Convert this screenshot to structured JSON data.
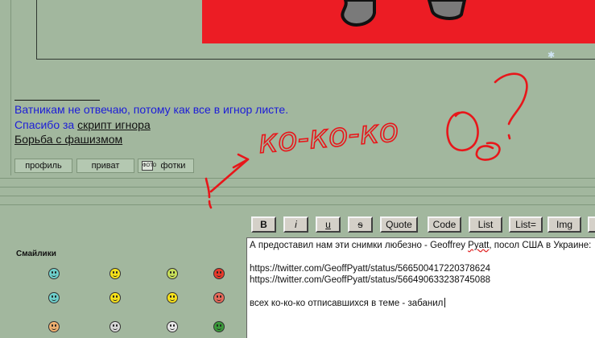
{
  "signature": {
    "line1": "Ватникам не отвечаю, потому как все в игнор листе.",
    "line2_prefix": "Спасибо за ",
    "line2_link": "скрипт игнора",
    "line3_link": "Борьба с фашизмом"
  },
  "post_buttons": {
    "profile": "профиль",
    "private": "приват",
    "photos": "фотки",
    "photos_icon_text": "ФОТО"
  },
  "scribble_text": "ко-ко-ко",
  "toolbar": {
    "bold": "B",
    "italic": "i",
    "underline": "u",
    "strike": "s",
    "quote": "Quote",
    "code": "Code",
    "list": "List",
    "list_eq": "List=",
    "img": "Img"
  },
  "smileys": {
    "title": "Смайлики",
    "items": [
      {
        "icon": "grin-smiley-icon",
        "color": "#6ed0cc"
      },
      {
        "icon": "smile-smiley-icon",
        "color": "#f7e21a"
      },
      {
        "icon": "smile-green-smiley-icon",
        "color": "#c8e05a"
      },
      {
        "icon": "angry-smiley-icon",
        "color": "#e83a2a"
      },
      {
        "icon": "cool-smiley-icon",
        "color": "#6ed0cc"
      },
      {
        "icon": "wink-smiley-icon",
        "color": "#f7e21a"
      },
      {
        "icon": "sad-smiley-icon",
        "color": "#f7e21a"
      },
      {
        "icon": "tongue-smiley-icon",
        "color": "#e86a5a"
      },
      {
        "icon": "laugh-smiley-icon",
        "color": "#f0b070"
      },
      {
        "icon": "ninja-smiley-icon",
        "color": "#d8d8d8"
      },
      {
        "icon": "idea-smiley-icon",
        "color": "#e8e8e8"
      },
      {
        "icon": "devil-smiley-icon",
        "color": "#3a9a3a"
      }
    ]
  },
  "message": {
    "line1_prefix": "А предоставил нам эти снимки любезно - Geoffrey ",
    "line1_spell": "Pyatt",
    "line1_suffix": ", посол США в Украине:",
    "line3": "https://twitter.com/GeoffPyatt/status/566500417220378624",
    "line4": "https://twitter.com/GeoffPyatt/status/566490633238745088",
    "line6": "всех ко-ко-ко отписавшихся в теме - забанил"
  }
}
